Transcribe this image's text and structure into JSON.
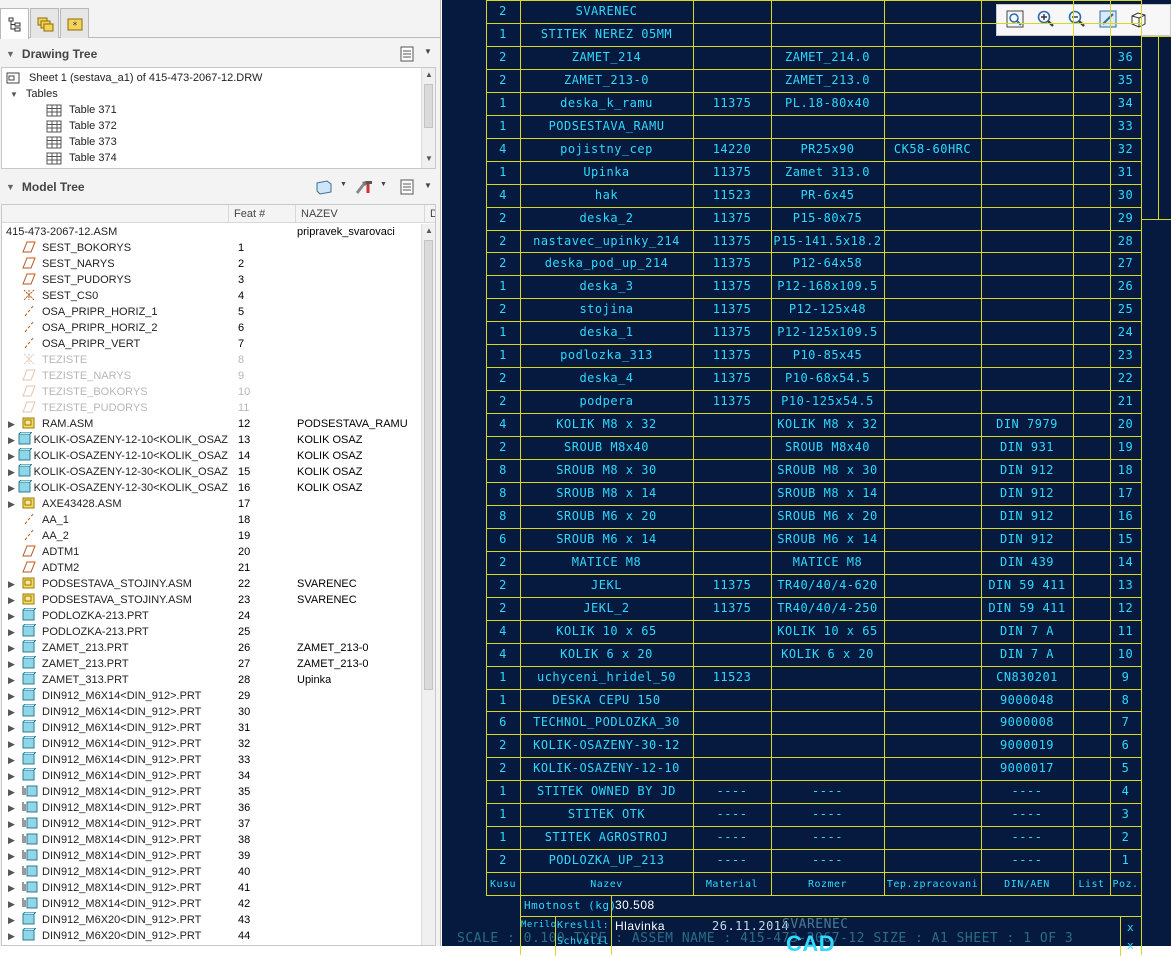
{
  "left_tabs": [
    {
      "icon": "model-tree-tab-icon"
    },
    {
      "icon": "layers-tab-icon"
    },
    {
      "icon": "favorites-tab-icon"
    }
  ],
  "drawing_tree": {
    "title": "Drawing Tree",
    "sheet": "Sheet 1 (sestava_a1) of 415-473-2067-12.DRW",
    "tables_label": "Tables",
    "tables": [
      "Table 371",
      "Table 372",
      "Table 373",
      "Table 374"
    ]
  },
  "model_tree": {
    "title": "Model Tree",
    "columns": {
      "feat": "Feat #",
      "nazev": "NAZEV",
      "extra": "D"
    },
    "root": {
      "name": "415-473-2067-12.ASM",
      "nazev": "pripravek_svarovaci"
    },
    "items": [
      {
        "name": "SEST_BOKORYS",
        "feat": "1",
        "nazev": "",
        "icon": "datum-plane",
        "dim": false,
        "expand": false
      },
      {
        "name": "SEST_NARYS",
        "feat": "2",
        "nazev": "",
        "icon": "datum-plane",
        "dim": false,
        "expand": false
      },
      {
        "name": "SEST_PUDORYS",
        "feat": "3",
        "nazev": "",
        "icon": "datum-plane",
        "dim": false,
        "expand": false
      },
      {
        "name": "SEST_CS0",
        "feat": "4",
        "nazev": "",
        "icon": "csys",
        "dim": false,
        "expand": false
      },
      {
        "name": "OSA_PRIPR_HORIZ_1",
        "feat": "5",
        "nazev": "",
        "icon": "axis",
        "dim": false,
        "expand": false
      },
      {
        "name": "OSA_PRIPR_HORIZ_2",
        "feat": "6",
        "nazev": "",
        "icon": "axis",
        "dim": false,
        "expand": false
      },
      {
        "name": "OSA_PRIPR_VERT",
        "feat": "7",
        "nazev": "",
        "icon": "axis",
        "dim": false,
        "expand": false
      },
      {
        "name": "TEZISTE",
        "feat": "8",
        "nazev": "",
        "icon": "csys",
        "dim": true,
        "expand": false
      },
      {
        "name": "TEZISTE_NARYS",
        "feat": "9",
        "nazev": "",
        "icon": "datum-plane",
        "dim": true,
        "expand": false
      },
      {
        "name": "TEZISTE_BOKORYS",
        "feat": "10",
        "nazev": "",
        "icon": "datum-plane",
        "dim": true,
        "expand": false
      },
      {
        "name": "TEZISTE_PUDORYS",
        "feat": "11",
        "nazev": "",
        "icon": "datum-plane",
        "dim": true,
        "expand": false
      },
      {
        "name": "RAM.ASM",
        "feat": "12",
        "nazev": "PODSESTAVA_RAMU",
        "icon": "assembly",
        "dim": false,
        "expand": true
      },
      {
        "name": "KOLIK-OSAZENY-12-10<KOLIK_OSAZ",
        "feat": "13",
        "nazev": "KOLIK OSAZ",
        "icon": "part",
        "dim": false,
        "expand": true
      },
      {
        "name": "KOLIK-OSAZENY-12-10<KOLIK_OSAZ",
        "feat": "14",
        "nazev": "KOLIK OSAZ",
        "icon": "part",
        "dim": false,
        "expand": true
      },
      {
        "name": "KOLIK-OSAZENY-12-30<KOLIK_OSAZ",
        "feat": "15",
        "nazev": "KOLIK OSAZ",
        "icon": "part",
        "dim": false,
        "expand": true
      },
      {
        "name": "KOLIK-OSAZENY-12-30<KOLIK_OSAZ",
        "feat": "16",
        "nazev": "KOLIK OSAZ",
        "icon": "part",
        "dim": false,
        "expand": true
      },
      {
        "name": "AXE43428.ASM",
        "feat": "17",
        "nazev": "",
        "icon": "assembly",
        "dim": false,
        "expand": true
      },
      {
        "name": "AA_1",
        "feat": "18",
        "nazev": "",
        "icon": "axis",
        "dim": false,
        "expand": false
      },
      {
        "name": "AA_2",
        "feat": "19",
        "nazev": "",
        "icon": "axis",
        "dim": false,
        "expand": false
      },
      {
        "name": "ADTM1",
        "feat": "20",
        "nazev": "",
        "icon": "datum-plane",
        "dim": false,
        "expand": false
      },
      {
        "name": "ADTM2",
        "feat": "21",
        "nazev": "",
        "icon": "datum-plane",
        "dim": false,
        "expand": false
      },
      {
        "name": "PODSESTAVA_STOJINY.ASM",
        "feat": "22",
        "nazev": "SVARENEC",
        "icon": "assembly",
        "dim": false,
        "expand": true
      },
      {
        "name": "PODSESTAVA_STOJINY.ASM",
        "feat": "23",
        "nazev": "SVARENEC",
        "icon": "assembly",
        "dim": false,
        "expand": true
      },
      {
        "name": "PODLOZKA-213.PRT",
        "feat": "24",
        "nazev": "",
        "icon": "part",
        "dim": false,
        "expand": true
      },
      {
        "name": "PODLOZKA-213.PRT",
        "feat": "25",
        "nazev": "",
        "icon": "part",
        "dim": false,
        "expand": true
      },
      {
        "name": "ZAMET_213.PRT",
        "feat": "26",
        "nazev": "ZAMET_213-0",
        "icon": "part",
        "dim": false,
        "expand": true
      },
      {
        "name": "ZAMET_213.PRT",
        "feat": "27",
        "nazev": "ZAMET_213-0",
        "icon": "part",
        "dim": false,
        "expand": true
      },
      {
        "name": "ZAMET_313.PRT",
        "feat": "28",
        "nazev": "Upinka",
        "icon": "part",
        "dim": false,
        "expand": true
      },
      {
        "name": "DIN912_M6X14<DIN_912>.PRT",
        "feat": "29",
        "nazev": "",
        "icon": "part",
        "dim": false,
        "expand": true
      },
      {
        "name": "DIN912_M6X14<DIN_912>.PRT",
        "feat": "30",
        "nazev": "",
        "icon": "part",
        "dim": false,
        "expand": true
      },
      {
        "name": "DIN912_M6X14<DIN_912>.PRT",
        "feat": "31",
        "nazev": "",
        "icon": "part",
        "dim": false,
        "expand": true
      },
      {
        "name": "DIN912_M6X14<DIN_912>.PRT",
        "feat": "32",
        "nazev": "",
        "icon": "part",
        "dim": false,
        "expand": true
      },
      {
        "name": "DIN912_M6X14<DIN_912>.PRT",
        "feat": "33",
        "nazev": "",
        "icon": "part",
        "dim": false,
        "expand": true
      },
      {
        "name": "DIN912_M6X14<DIN_912>.PRT",
        "feat": "34",
        "nazev": "",
        "icon": "part",
        "dim": false,
        "expand": true
      },
      {
        "name": "DIN912_M8X14<DIN_912>.PRT",
        "feat": "35",
        "nazev": "",
        "icon": "part-pattern",
        "dim": false,
        "expand": true
      },
      {
        "name": "DIN912_M8X14<DIN_912>.PRT",
        "feat": "36",
        "nazev": "",
        "icon": "part-pattern",
        "dim": false,
        "expand": true
      },
      {
        "name": "DIN912_M8X14<DIN_912>.PRT",
        "feat": "37",
        "nazev": "",
        "icon": "part-pattern",
        "dim": false,
        "expand": true
      },
      {
        "name": "DIN912_M8X14<DIN_912>.PRT",
        "feat": "38",
        "nazev": "",
        "icon": "part-pattern",
        "dim": false,
        "expand": true
      },
      {
        "name": "DIN912_M8X14<DIN_912>.PRT",
        "feat": "39",
        "nazev": "",
        "icon": "part-pattern",
        "dim": false,
        "expand": true
      },
      {
        "name": "DIN912_M8X14<DIN_912>.PRT",
        "feat": "40",
        "nazev": "",
        "icon": "part-pattern",
        "dim": false,
        "expand": true
      },
      {
        "name": "DIN912_M8X14<DIN_912>.PRT",
        "feat": "41",
        "nazev": "",
        "icon": "part-pattern",
        "dim": false,
        "expand": true
      },
      {
        "name": "DIN912_M8X14<DIN_912>.PRT",
        "feat": "42",
        "nazev": "",
        "icon": "part-pattern",
        "dim": false,
        "expand": true
      },
      {
        "name": "DIN912_M6X20<DIN_912>.PRT",
        "feat": "43",
        "nazev": "",
        "icon": "part",
        "dim": false,
        "expand": true
      },
      {
        "name": "DIN912_M6X20<DIN_912>.PRT",
        "feat": "44",
        "nazev": "",
        "icon": "part",
        "dim": false,
        "expand": true
      }
    ]
  },
  "bom": {
    "rows": [
      [
        "2",
        "SVARENEC",
        "",
        "",
        "",
        "",
        ""
      ],
      [
        "1",
        "STITEK NEREZ 05MM",
        "",
        "",
        "",
        "",
        ""
      ],
      [
        "2",
        "ZAMET_214",
        "",
        "ZAMET_214.0",
        "",
        "",
        "36"
      ],
      [
        "2",
        "ZAMET_213-0",
        "",
        "ZAMET_213.0",
        "",
        "",
        "35"
      ],
      [
        "1",
        "deska_k_ramu",
        "11375",
        "PL.18-80x40",
        "",
        "",
        "34"
      ],
      [
        "1",
        "PODSESTAVA_RAMU",
        "",
        "",
        "",
        "",
        "33"
      ],
      [
        "4",
        "pojistny_cep",
        "14220",
        "PR25x90",
        "CK58-60HRC",
        "",
        "32"
      ],
      [
        "1",
        "Upinka",
        "11375",
        "Zamet 313.0",
        "",
        "",
        "31"
      ],
      [
        "4",
        "hak",
        "11523",
        "PR-6x45",
        "",
        "",
        "30"
      ],
      [
        "2",
        "deska_2",
        "11375",
        "P15-80x75",
        "",
        "",
        "29"
      ],
      [
        "2",
        "nastavec_upinky_214",
        "11375",
        "P15-141.5x18.2",
        "",
        "",
        "28"
      ],
      [
        "2",
        "deska_pod_up_214",
        "11375",
        "P12-64x58",
        "",
        "",
        "27"
      ],
      [
        "1",
        "deska_3",
        "11375",
        "P12-168x109.5",
        "",
        "",
        "26"
      ],
      [
        "2",
        "stojina",
        "11375",
        "P12-125x48",
        "",
        "",
        "25"
      ],
      [
        "1",
        "deska_1",
        "11375",
        "P12-125x109.5",
        "",
        "",
        "24"
      ],
      [
        "1",
        "podlozka_313",
        "11375",
        "P10-85x45",
        "",
        "",
        "23"
      ],
      [
        "2",
        "deska_4",
        "11375",
        "P10-68x54.5",
        "",
        "",
        "22"
      ],
      [
        "2",
        "podpera",
        "11375",
        "P10-125x54.5",
        "",
        "",
        "21"
      ],
      [
        "4",
        "KOLIK M8 x 32",
        "",
        "KOLIK M8 x 32",
        "",
        "DIN 7979",
        "20"
      ],
      [
        "2",
        "SROUB M8x40",
        "",
        "SROUB M8x40",
        "",
        "DIN 931",
        "19"
      ],
      [
        "8",
        "SROUB M8 x 30",
        "",
        "SROUB M8 x 30",
        "",
        "DIN 912",
        "18"
      ],
      [
        "8",
        "SROUB M8 x 14",
        "",
        "SROUB M8 x 14",
        "",
        "DIN 912",
        "17"
      ],
      [
        "8",
        "SROUB M6 x 20",
        "",
        "SROUB M6 x 20",
        "",
        "DIN 912",
        "16"
      ],
      [
        "6",
        "SROUB M6 x 14",
        "",
        "SROUB M6 x 14",
        "",
        "DIN 912",
        "15"
      ],
      [
        "2",
        "MATICE M8",
        "",
        "MATICE M8",
        "",
        "DIN 439",
        "14"
      ],
      [
        "2",
        "JEKL",
        "11375",
        "TR40/40/4-620",
        "",
        "DIN 59 411",
        "13"
      ],
      [
        "2",
        "JEKL_2",
        "11375",
        "TR40/40/4-250",
        "",
        "DIN 59 411",
        "12"
      ],
      [
        "4",
        "KOLIK 10 x 65",
        "",
        "KOLIK 10 x 65",
        "",
        "DIN 7 A",
        "11"
      ],
      [
        "4",
        "KOLIK 6 x 20",
        "",
        "KOLIK 6 x 20",
        "",
        "DIN 7 A",
        "10"
      ],
      [
        "1",
        "uchyceni_hridel_50",
        "11523",
        "",
        "",
        "CN830201",
        "9"
      ],
      [
        "1",
        "DESKA CEPU 150",
        "",
        "",
        "",
        "9000048",
        "8"
      ],
      [
        "6",
        "TECHNOL_PODLOZKA_30",
        "",
        "",
        "",
        "9000008",
        "7"
      ],
      [
        "2",
        "KOLIK-OSAZENY-30-12",
        "",
        "",
        "",
        "9000019",
        "6"
      ],
      [
        "2",
        "KOLIK-OSAZENY-12-10",
        "",
        "",
        "",
        "9000017",
        "5"
      ],
      [
        "1",
        "STITEK OWNED BY JD",
        "----",
        "----",
        "",
        "----",
        "4"
      ],
      [
        "1",
        "STITEK OTK",
        "----",
        "----",
        "",
        "----",
        "3"
      ],
      [
        "1",
        "STITEK AGROSTROJ",
        "----",
        "----",
        "",
        "----",
        "2"
      ],
      [
        "2",
        "PODLOZKA_UP_213",
        "----",
        "----",
        "",
        "----",
        "1"
      ]
    ],
    "header": [
      "Kusu",
      "Nazev",
      "Material",
      "Rozmer",
      "Tep.zpracovani",
      "DIN/AEN",
      "List",
      "Poz."
    ],
    "mass_label": "Hmotnost (kg)",
    "mass_value": "30.508",
    "meril_label": "Merilo",
    "kreslil_label": "Kreslil:",
    "kreslil_value": "Hlavinka",
    "date_value": "26.11.2014",
    "schvalil_label": "Schvalil",
    "svarenec_label": "SVARENEC",
    "cad_label": "CAD",
    "x_marks": [
      "x",
      "x"
    ]
  },
  "status_line": "SCALE : 0.100   TYPE : ASSEM   NAME : 415-473-2067-12   SIZE : A1   SHEET : 1 OF 3",
  "view_toolbar": [
    {
      "icon": "refit-icon"
    },
    {
      "icon": "zoom-in-icon"
    },
    {
      "icon": "zoom-out-icon"
    },
    {
      "icon": "repaint-icon"
    },
    {
      "icon": "view-mode-icon"
    }
  ]
}
